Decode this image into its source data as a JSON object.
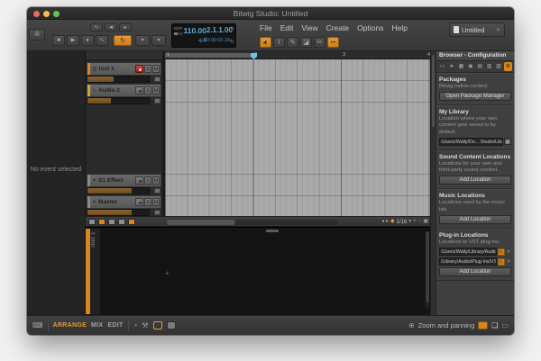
{
  "window": {
    "title": "Bitwig Studio: Untitled"
  },
  "doc_tab": {
    "label": "Untitled",
    "close": "✕"
  },
  "menubar": {
    "items": [
      "File",
      "Edit",
      "View",
      "Create",
      "Options",
      "Help"
    ]
  },
  "transport": {
    "dsp_label": "DSP",
    "tempo": "110.00",
    "time_sig": "4/4",
    "position": "2.1.1.00",
    "time": "00:00:02.18"
  },
  "icons": {
    "bitwig_menu": "✇",
    "stop": "■",
    "play": "▶",
    "record": "●",
    "automation": "∿",
    "loop": "↻",
    "dropdown": "▾",
    "metronome": "◬",
    "pointer": "➤",
    "ibeam": "I",
    "pencil": "✎",
    "eraser": "◪",
    "knife": "✂",
    "snap_tool": "↦",
    "pencil_small": "✎",
    "punch": "◄",
    "left": "◂",
    "right": "▸",
    "snap_grid": "◆",
    "zoom_in": "+",
    "zoom_out": "−",
    "fit": "▣",
    "browser_tab_devices": "▭",
    "browser_tab_presets": "➤",
    "browser_tab_samples": "▦",
    "browser_tab_multis": "◉",
    "browser_tab_music": "▤",
    "browser_tab_files": "▥",
    "browser_tab_packages": "▧",
    "browser_tab_settings": "⚙",
    "refresh": "↻",
    "close": "✕",
    "folder": "▦",
    "track_inst": "▥",
    "track_audio": "∿",
    "track_fx": "✦",
    "track_master": "✶",
    "keyboard": "⌨",
    "dial": "◔",
    "hammer": "⚒",
    "pan": "⊕",
    "page": "❏",
    "monitor": "▭",
    "plus_cross": "+"
  },
  "labels": {
    "solo": "S",
    "mute": "M"
  },
  "arranger": {
    "ruler": [
      "1",
      "2",
      "3",
      "4"
    ],
    "grid_value": "1/16",
    "tracks": [
      {
        "name": "Inst 1",
        "color": "#d9861f",
        "vol": "42%"
      },
      {
        "name": "Audio 2",
        "color": "#d2a92c",
        "vol": "38%"
      },
      {
        "name": "S1 Effect",
        "color": "#8a8a8a",
        "vol": "72%"
      },
      {
        "name": "Master",
        "color": "#8a8a8a",
        "vol": "72%"
      }
    ]
  },
  "inspector": {
    "empty_text": "No event selected"
  },
  "editor": {
    "track_label": "Inst 1"
  },
  "browser": {
    "title": "Browser - Configuration",
    "sections": {
      "packages": {
        "title": "Packages",
        "desc": "Bitwig native content.",
        "button": "Open Package Manager"
      },
      "library": {
        "title": "My Library",
        "desc": "Location where your own content gets saved to by default.",
        "path": "/Users/Wally/Do... Studio/Library"
      },
      "sound": {
        "title": "Sound Content Locations",
        "desc": "Locations for your own and third-party sound content.",
        "button": "Add Location"
      },
      "music": {
        "title": "Music Locations",
        "desc": "Locations used by the music tab.",
        "button": "Add Location"
      },
      "plugins": {
        "title": "Plug-in Locations",
        "desc": "Locations to VST plug-ins.",
        "paths": [
          "/Users/Wally/Library/Audio/...",
          "/Library/Audio/Plug-Ins/VST"
        ],
        "button": "Add Location"
      }
    }
  },
  "statusbar": {
    "views": [
      {
        "label": "ARRANGE"
      },
      {
        "label": "MIX"
      },
      {
        "label": "EDIT"
      }
    ],
    "zoom_label": "Zoom and panning"
  },
  "colors": {
    "accent": "#d9861f",
    "playhead": "#6fc2e8",
    "record": "#c23b36"
  }
}
